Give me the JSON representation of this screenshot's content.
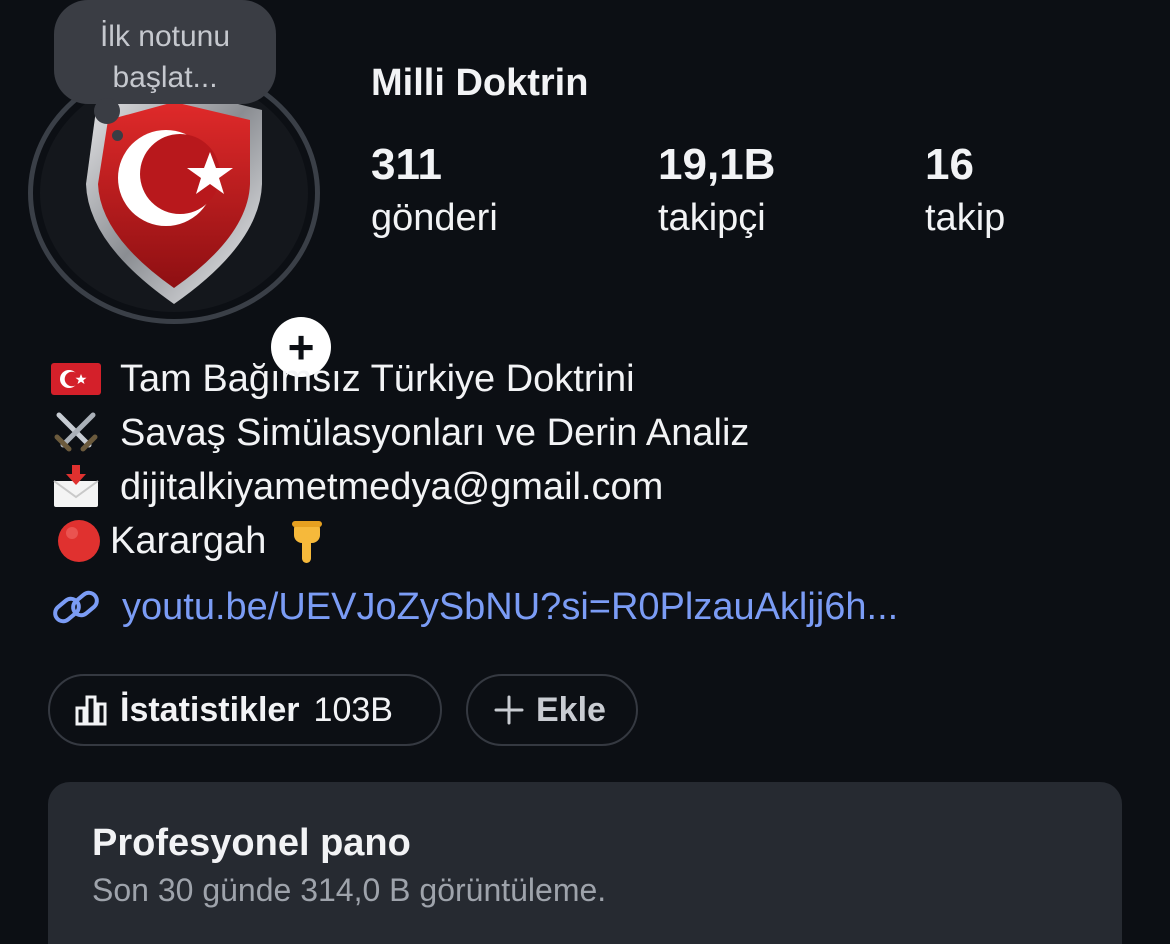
{
  "note": {
    "text_line1": "İlk notunu",
    "text_line2": "başlat..."
  },
  "profile": {
    "name": "Milli Doktrin",
    "stats": [
      {
        "value": "311",
        "label": "gönderi"
      },
      {
        "value": "19,1B",
        "label": "takipçi"
      },
      {
        "value": "16",
        "label": "takip"
      }
    ]
  },
  "bio": {
    "lines": [
      {
        "emoji": "turkey-flag",
        "text": "Tam Bağımsız Türkiye Doktrini"
      },
      {
        "emoji": "crossed-swords",
        "text": "Savaş Simülasyonları ve Derin Analiz"
      },
      {
        "emoji": "envelope-with-arrow",
        "text": "dijitalkiyametmedya@gmail.com"
      },
      {
        "emoji": "red-circle",
        "text": "Karargah",
        "trailing_emoji": "backhand-index-pointing-down"
      }
    ],
    "link": {
      "icon": "link-icon",
      "text": "youtu.be/UEVJoZySbNU?si=R0PlzauAkljj6h..."
    }
  },
  "buttons": {
    "insights": {
      "icon": "bar-chart-icon",
      "label": "İstatistikler",
      "count": "103B"
    },
    "add": {
      "icon": "plus-icon",
      "label": "Ekle"
    }
  },
  "dashboard": {
    "title": "Profesyonel pano",
    "subtitle": "Son 30 günde 314,0 B görüntüleme."
  },
  "colors": {
    "background": "#0c0f14",
    "link": "#7b9cf5",
    "card": "#262a31",
    "flag_red": "#d4202a"
  }
}
